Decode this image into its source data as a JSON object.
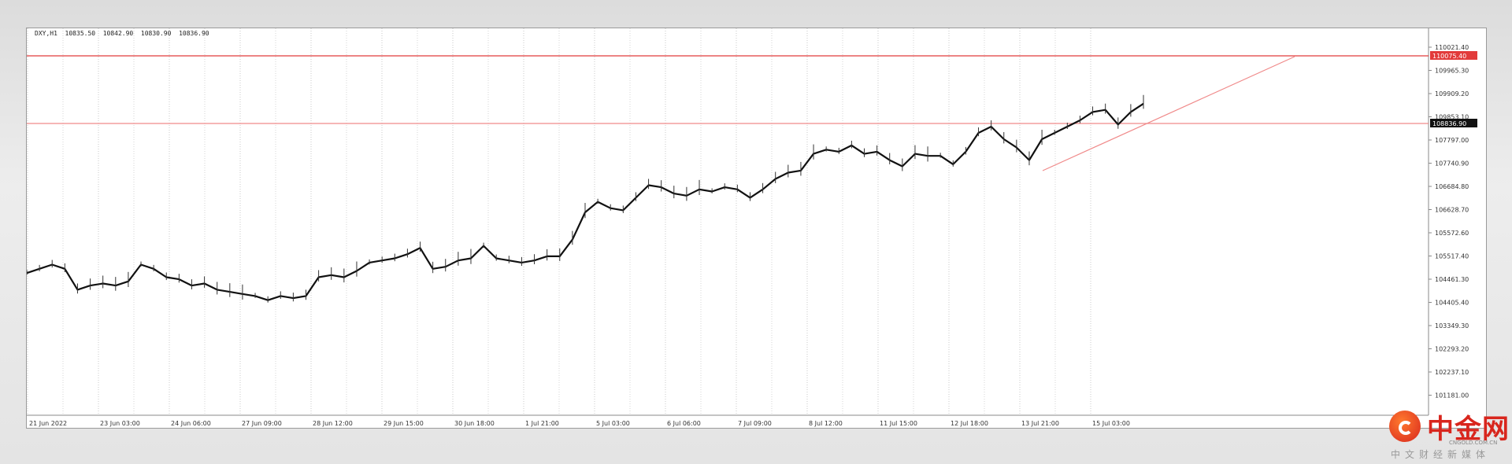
{
  "chart_data": {
    "type": "line",
    "symbol": "DXY,H1",
    "ohlc": [
      "10835.50",
      "10842.90",
      "10830.90",
      "10836.90"
    ],
    "y_ticks": [
      "110021.40",
      "109965.30",
      "109909.20",
      "109853.10",
      "107797.00",
      "107740.90",
      "106684.80",
      "106628.70",
      "105572.60",
      "105517.40",
      "104461.30",
      "104405.40",
      "103349.30",
      "102293.20",
      "102237.10",
      "101181.00"
    ],
    "x_ticks": [
      "21 Jun 2022",
      "23 Jun 03:00",
      "24 Jun 06:00",
      "27 Jun 09:00",
      "28 Jun 12:00",
      "29 Jun 15:00",
      "30 Jun 18:00",
      "1 Jul 21:00",
      "5 Jul 03:00",
      "6 Jul 06:00",
      "7 Jul 09:00",
      "8 Jul 12:00",
      "11 Jul 15:00",
      "12 Jul 18:00",
      "13 Jul 21:00",
      "15 Jul 03:00"
    ],
    "price_labels": {
      "resistance": "110075.40",
      "current": "108836.90"
    },
    "series": [
      {
        "values": [
          104.5,
          104.6,
          104.7,
          104.6,
          104.1,
          104.2,
          104.25,
          104.2,
          104.3,
          104.7,
          104.6,
          104.4,
          104.35,
          104.2,
          104.25,
          104.1,
          104.05,
          104.0,
          103.95,
          103.85,
          103.95,
          103.9,
          103.95,
          104.4,
          104.45,
          104.4,
          104.55,
          104.75,
          104.8,
          104.85,
          104.95,
          105.1,
          104.6,
          104.65,
          104.8,
          104.85,
          105.15,
          104.85,
          104.8,
          104.75,
          104.8,
          104.9,
          104.9,
          105.3,
          105.95,
          106.2,
          106.05,
          106.0,
          106.3,
          106.6,
          106.55,
          106.4,
          106.35,
          106.5,
          106.45,
          106.55,
          106.5,
          106.3,
          106.5,
          106.75,
          106.9,
          106.95,
          107.35,
          107.45,
          107.4,
          107.55,
          107.35,
          107.4,
          107.2,
          107.05,
          107.35,
          107.3,
          107.3,
          107.1,
          107.4,
          107.85,
          108.0,
          107.7,
          107.5,
          107.2,
          107.7,
          107.85,
          108.0,
          108.15,
          108.35,
          108.4,
          108.05,
          108.35,
          108.55
        ]
      }
    ],
    "y_min": 101.1,
    "y_max": 110.2
  }
}
